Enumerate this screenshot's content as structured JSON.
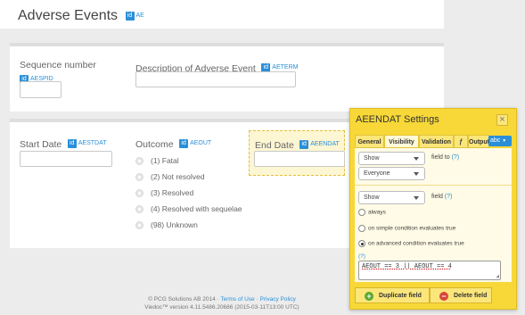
{
  "page": {
    "title": "Adverse Events",
    "title_var": "AE"
  },
  "form": {
    "sequence": {
      "label": "Sequence number",
      "var": "AESPID"
    },
    "description": {
      "label": "Description of Adverse Event",
      "var": "AETERM"
    },
    "start_date": {
      "label": "Start Date",
      "var": "AESTDAT"
    },
    "outcome": {
      "label": "Outcome",
      "var": "AEOUT",
      "options": [
        "(1) Fatal",
        "(2) Not resolved",
        "(3) Resolved",
        "(4) Resolved with sequelae",
        "(98) Unknown"
      ]
    },
    "end_date": {
      "label": "End Date",
      "var": "AEENDAT"
    }
  },
  "badge_text": "id",
  "footer": {
    "copyright": "© PCG Solutions AB 2014 · ",
    "terms": "Terms of Use",
    "separator": " · ",
    "privacy": "Privacy Policy",
    "version": "Viedoc™ version 4.11.5486.20686 (2015-03-11T13:00 UTC)"
  },
  "settings": {
    "title": "AEENDAT Settings",
    "tabs": [
      "General",
      "Visibility",
      "Validation",
      "ƒ",
      "Output"
    ],
    "active_tab": "Visibility",
    "abc_label": "abc",
    "field_to": {
      "show_value": "Show",
      "role_value": "Everyone",
      "label": "field to",
      "help": "(?)"
    },
    "field": {
      "show_value": "Show",
      "label": "field",
      "help": "(?)"
    },
    "conditions": [
      "always",
      "on simple condition evaluates true",
      "on advanced condition evaluates true"
    ],
    "selected_condition": "on advanced condition evaluates true",
    "expr_help": "(?)",
    "expression": "AEOUT == 3 || AEOUT == 4",
    "duplicate_label": "Duplicate field",
    "delete_label": "Delete field"
  },
  "colors": {
    "accent": "#2a8fd8",
    "panel": "#f8d838",
    "background": "#ececec"
  }
}
